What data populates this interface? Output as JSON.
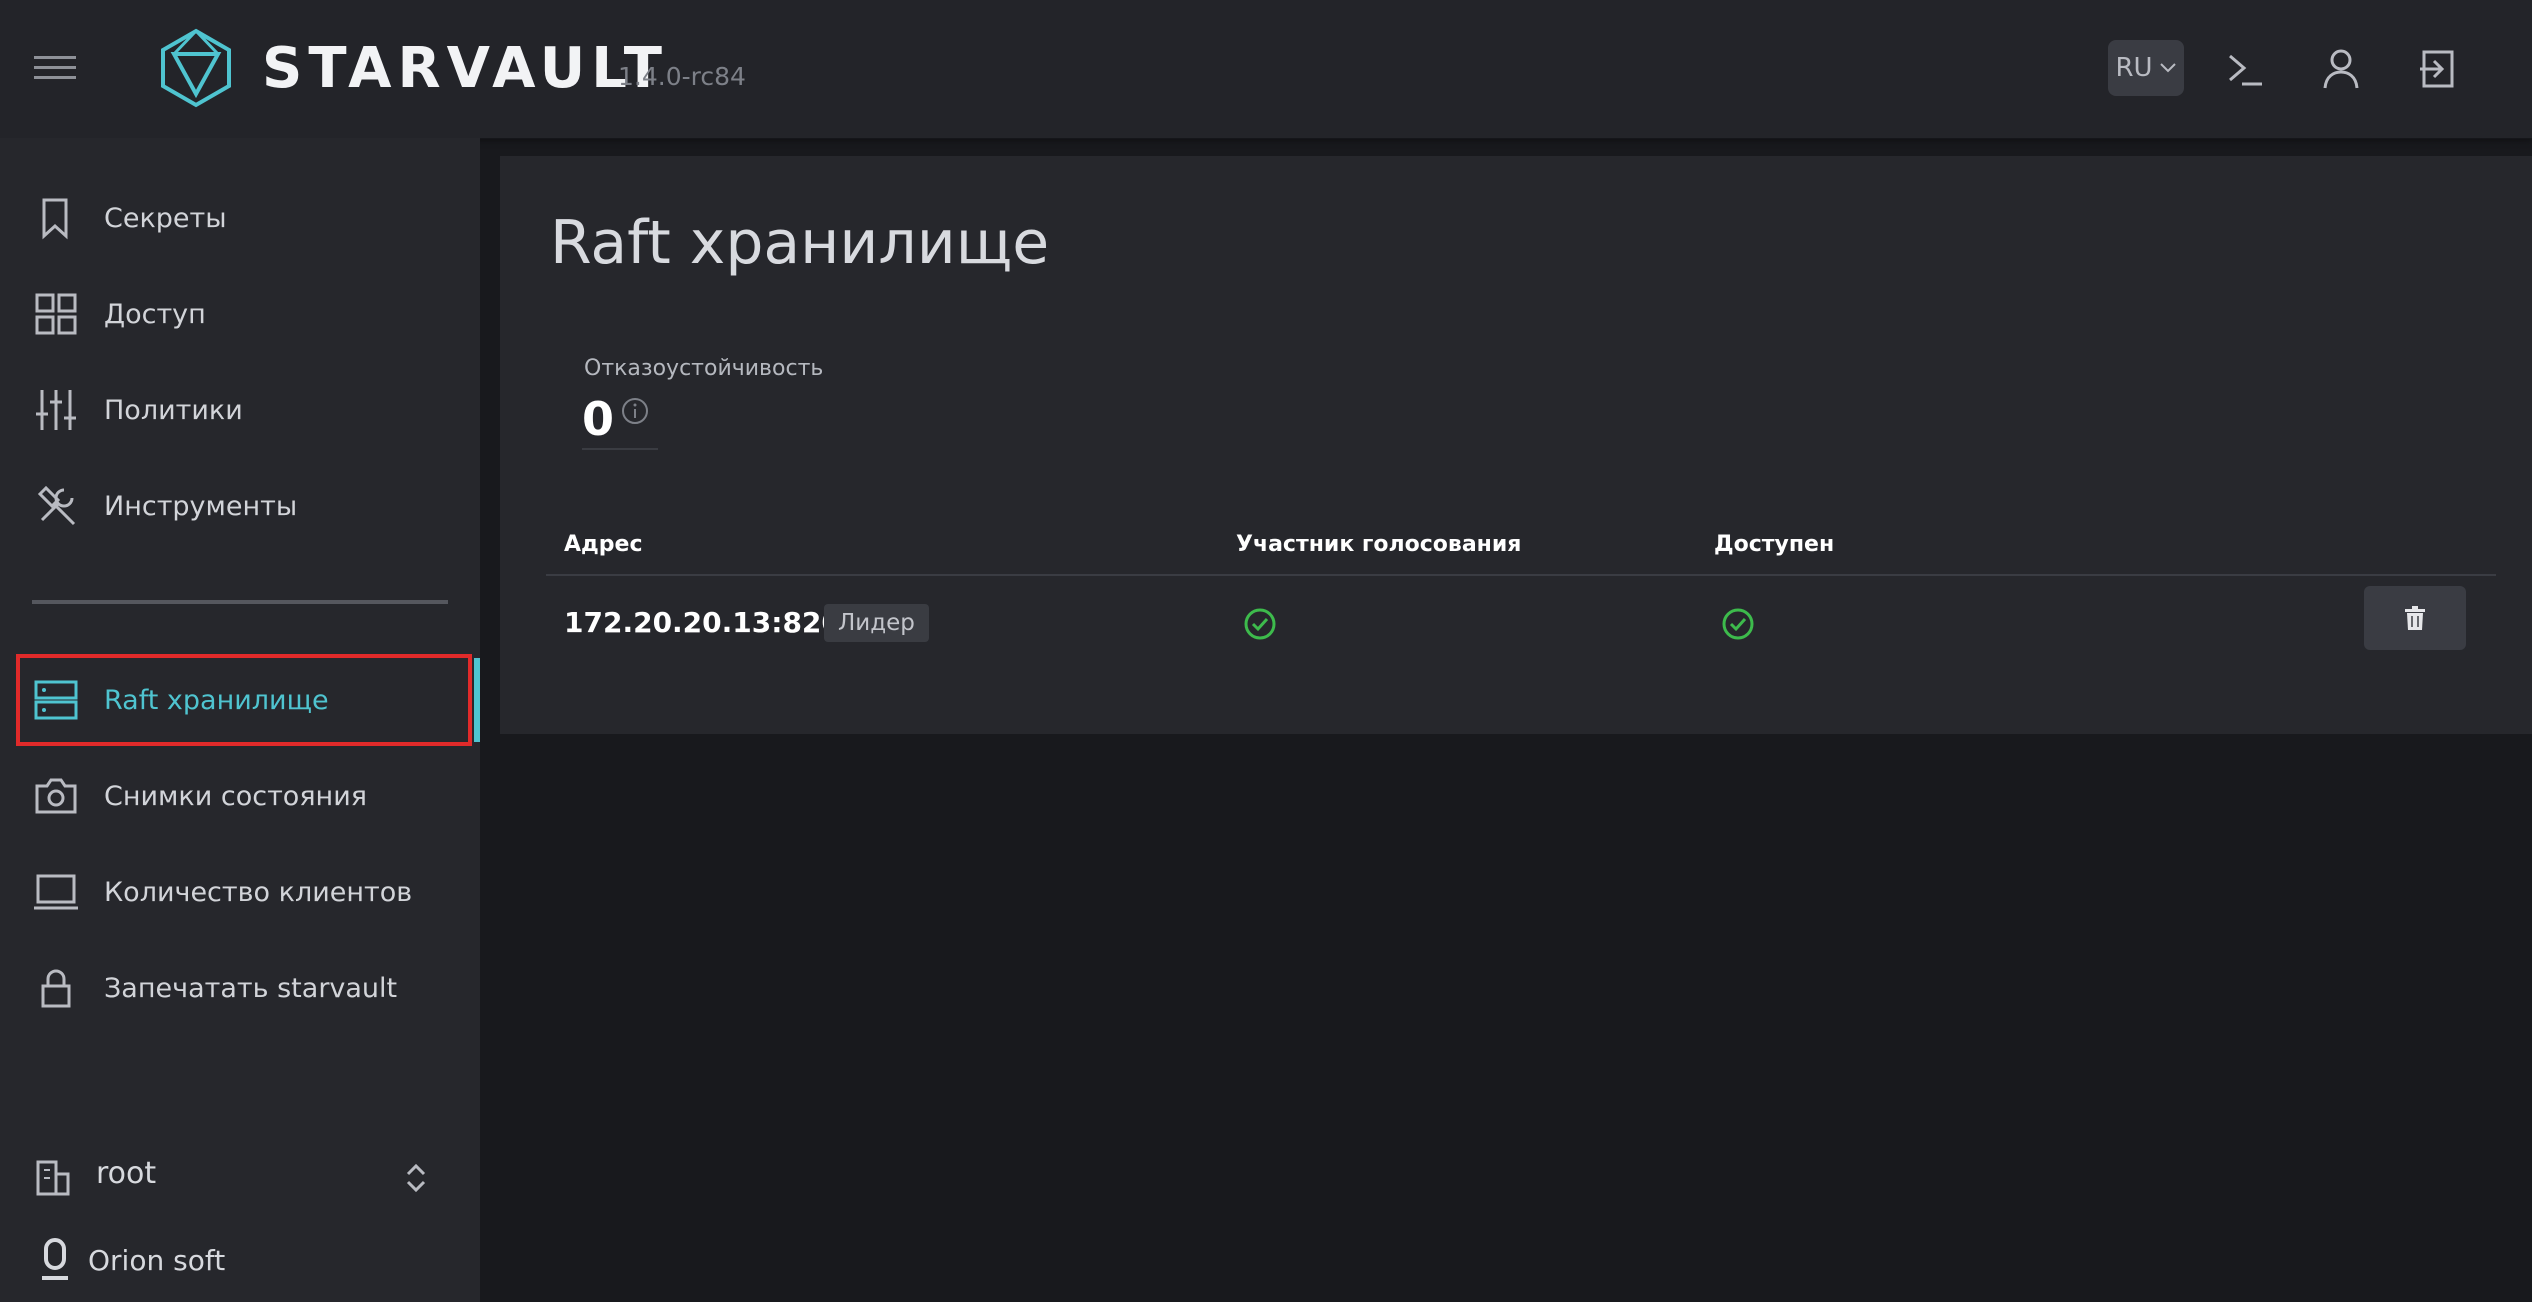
{
  "header": {
    "brand": "STARVAULT",
    "version": "1.4.0-rc84",
    "lang": "RU"
  },
  "sidebar": {
    "items": [
      {
        "label": "Секреты",
        "icon": "bookmark-icon"
      },
      {
        "label": "Доступ",
        "icon": "grid-icon"
      },
      {
        "label": "Политики",
        "icon": "sliders-icon"
      },
      {
        "label": "Инструменты",
        "icon": "tools-icon"
      },
      {
        "label": "Raft хранилище",
        "icon": "server-icon",
        "active": true
      },
      {
        "label": "Снимки состояния",
        "icon": "camera-icon"
      },
      {
        "label": "Количество клиентов",
        "icon": "laptop-icon"
      },
      {
        "label": "Запечатать starvault",
        "icon": "lock-icon"
      }
    ],
    "namespace": "root",
    "org": "Orion soft"
  },
  "main": {
    "title": "Raft хранилище",
    "stat_label": "Отказоустойчивость",
    "stat_value": "0",
    "columns": [
      "Адрес",
      "Участник голосования",
      "Доступен"
    ],
    "rows": [
      {
        "address": "172.20.20.13:8201",
        "tag": "Лидер",
        "voter": true,
        "available": true
      }
    ]
  },
  "colors": {
    "accent": "#4fc4d0",
    "success": "#3dbb4c",
    "highlight": "#e02a2a"
  }
}
